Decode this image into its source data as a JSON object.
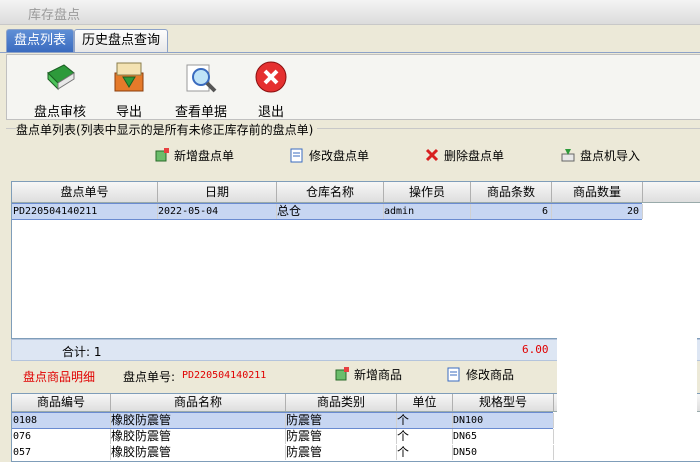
{
  "window": {
    "title": "库存盘点"
  },
  "tabs": [
    {
      "label": "盘点列表"
    },
    {
      "label": "历史盘点查询"
    }
  ],
  "toolbar": {
    "audit": "盘点审核",
    "export": "导出",
    "view": "查看单据",
    "exit": "退出"
  },
  "list_group": {
    "label": "盘点单列表(列表中显示的是所有未修正库存前的盘点单)"
  },
  "list_actions": {
    "add": "新增盘点单",
    "edit": "修改盘点单",
    "delete": "删除盘点单",
    "import": "盘点机导入"
  },
  "list_table": {
    "headers": [
      "盘点单号",
      "日期",
      "仓库名称",
      "操作员",
      "商品条数",
      "商品数量"
    ],
    "rows": [
      {
        "no": "PD220504140211",
        "date": "2022-05-04",
        "warehouse": "总仓",
        "operator": "admin",
        "items": "6",
        "qty": "20"
      }
    ]
  },
  "footer": {
    "label": "合计: 1",
    "total": "6.00"
  },
  "detail": {
    "title": "盘点商品明细",
    "no_label": "盘点单号:",
    "no_value": "PD220504140211",
    "add": "新增商品",
    "edit": "修改商品"
  },
  "detail_table": {
    "headers": [
      "商品编号",
      "商品名称",
      "商品类别",
      "单位",
      "规格型号"
    ],
    "rows": [
      {
        "code": "0108",
        "name": "橡胶防震管",
        "category": "防震管",
        "unit": "个",
        "spec": "DN100"
      },
      {
        "code": "076",
        "name": "橡胶防震管",
        "category": "防震管",
        "unit": "个",
        "spec": "DN65"
      },
      {
        "code": "057",
        "name": "橡胶防震管",
        "category": "防震管",
        "unit": "个",
        "spec": "DN50"
      }
    ]
  },
  "colors": {
    "accent": "#3a6bbf",
    "selected_row": "#c7d6f2",
    "red_text": "#e00000"
  }
}
